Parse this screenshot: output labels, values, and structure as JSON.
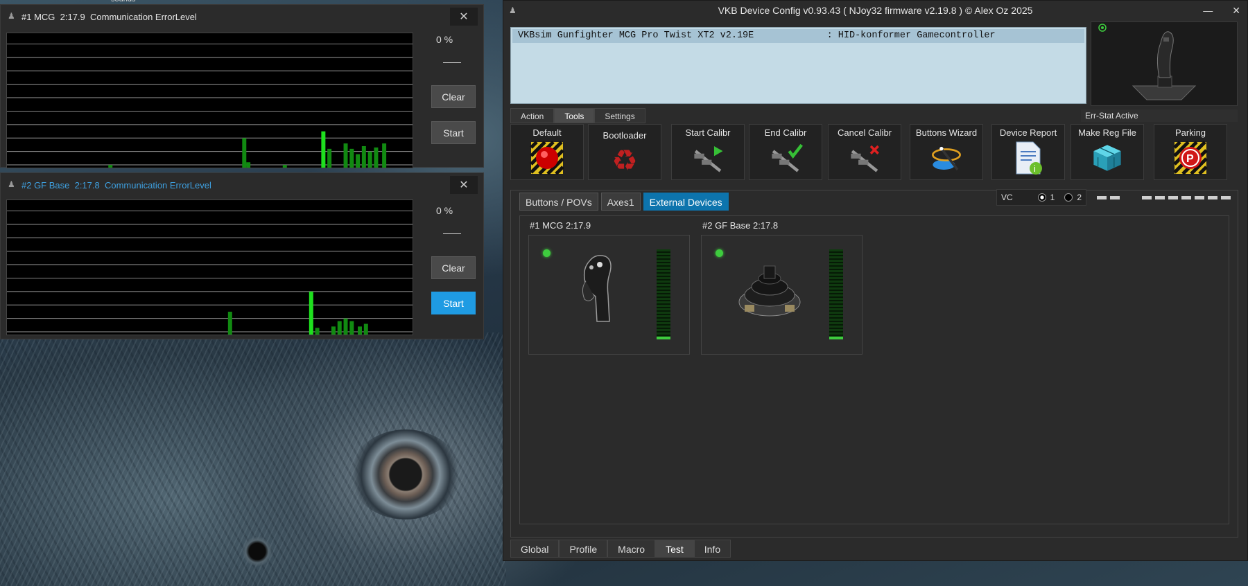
{
  "desktop": {
    "corner_text": "sounds"
  },
  "err_windows": [
    {
      "title": "#1 MCG  2:17.9  Communication ErrorLevel",
      "title_color": "#e6e6e6",
      "close": "✕",
      "percent": "0 %",
      "clear_label": "Clear",
      "start_label": "Start",
      "start_active": false,
      "bars": [
        {
          "pos": 0.25,
          "h": 0.02
        },
        {
          "pos": 0.58,
          "h": 0.22
        },
        {
          "pos": 0.59,
          "h": 0.04
        },
        {
          "pos": 0.68,
          "h": 0.02
        },
        {
          "pos": 0.775,
          "h": 0.27
        },
        {
          "pos": 0.79,
          "h": 0.14
        },
        {
          "pos": 0.83,
          "h": 0.18
        },
        {
          "pos": 0.845,
          "h": 0.14
        },
        {
          "pos": 0.86,
          "h": 0.1
        },
        {
          "pos": 0.875,
          "h": 0.16
        },
        {
          "pos": 0.89,
          "h": 0.12
        },
        {
          "pos": 0.905,
          "h": 0.15
        },
        {
          "pos": 0.925,
          "h": 0.18
        }
      ]
    },
    {
      "title": "#2 GF Base  2:17.8  Communication ErrorLevel",
      "title_color": "#3ea0e0",
      "close": "✕",
      "percent": "0 %",
      "clear_label": "Clear",
      "start_label": "Start",
      "start_active": true,
      "bars": [
        {
          "pos": 0.545,
          "h": 0.17
        },
        {
          "pos": 0.745,
          "h": 0.32
        },
        {
          "pos": 0.76,
          "h": 0.05
        },
        {
          "pos": 0.8,
          "h": 0.06
        },
        {
          "pos": 0.815,
          "h": 0.1
        },
        {
          "pos": 0.83,
          "h": 0.12
        },
        {
          "pos": 0.845,
          "h": 0.1
        },
        {
          "pos": 0.865,
          "h": 0.06
        },
        {
          "pos": 0.88,
          "h": 0.08
        }
      ]
    }
  ],
  "main": {
    "title": "VKB Device Config v0.93.43 ( NJoy32 firmware v2.19.8 ) © Alex Oz 2025",
    "window_buttons": [
      "—",
      "✕"
    ],
    "device_row": "VKBsim Gunfighter MCG Pro Twist XT2 v2.19E             : HID-konformer Gamecontroller",
    "err_stat": "Err-Stat Active",
    "top_tabs": [
      {
        "label": "Action",
        "active": false
      },
      {
        "label": "Tools",
        "active": true
      },
      {
        "label": "Settings",
        "active": false
      }
    ],
    "tools": [
      {
        "label": "Default",
        "icon": "red-button-icon"
      },
      {
        "label": "Bootloader",
        "icon": "recycle-icon"
      },
      {
        "label": "Start Calibr",
        "icon": "caliper-play-icon"
      },
      {
        "label": "End Calibr",
        "icon": "caliper-check-icon"
      },
      {
        "label": "Cancel Calibr",
        "icon": "caliper-cancel-icon"
      },
      {
        "label": "Buttons Wizard",
        "icon": "wand-icon"
      },
      {
        "label": "Device Report",
        "icon": "report-icon"
      },
      {
        "label": "Make Reg File",
        "icon": "cube-icon"
      },
      {
        "label": "Parking",
        "icon": "parking-icon"
      }
    ],
    "sub_tabs": [
      {
        "label": "Buttons / POVs",
        "active": false
      },
      {
        "label": "Axes1",
        "active": false
      },
      {
        "label": "External Devices",
        "active": true
      }
    ],
    "vc": {
      "label": "VC",
      "options": [
        "1",
        "2"
      ],
      "selected": "1"
    },
    "external_devices": [
      {
        "label": "#1 MCG 2:17.9",
        "image": "joystick-grip-icon",
        "level": 0.03
      },
      {
        "label": "#2 GF Base 2:17.8",
        "image": "gimbal-base-icon",
        "level": 0.03
      }
    ],
    "bottom_tabs": [
      {
        "label": "Global",
        "active": false
      },
      {
        "label": "Profile",
        "active": false
      },
      {
        "label": "Macro",
        "active": false
      },
      {
        "label": "Test",
        "active": true
      },
      {
        "label": "Info",
        "active": false
      }
    ]
  }
}
